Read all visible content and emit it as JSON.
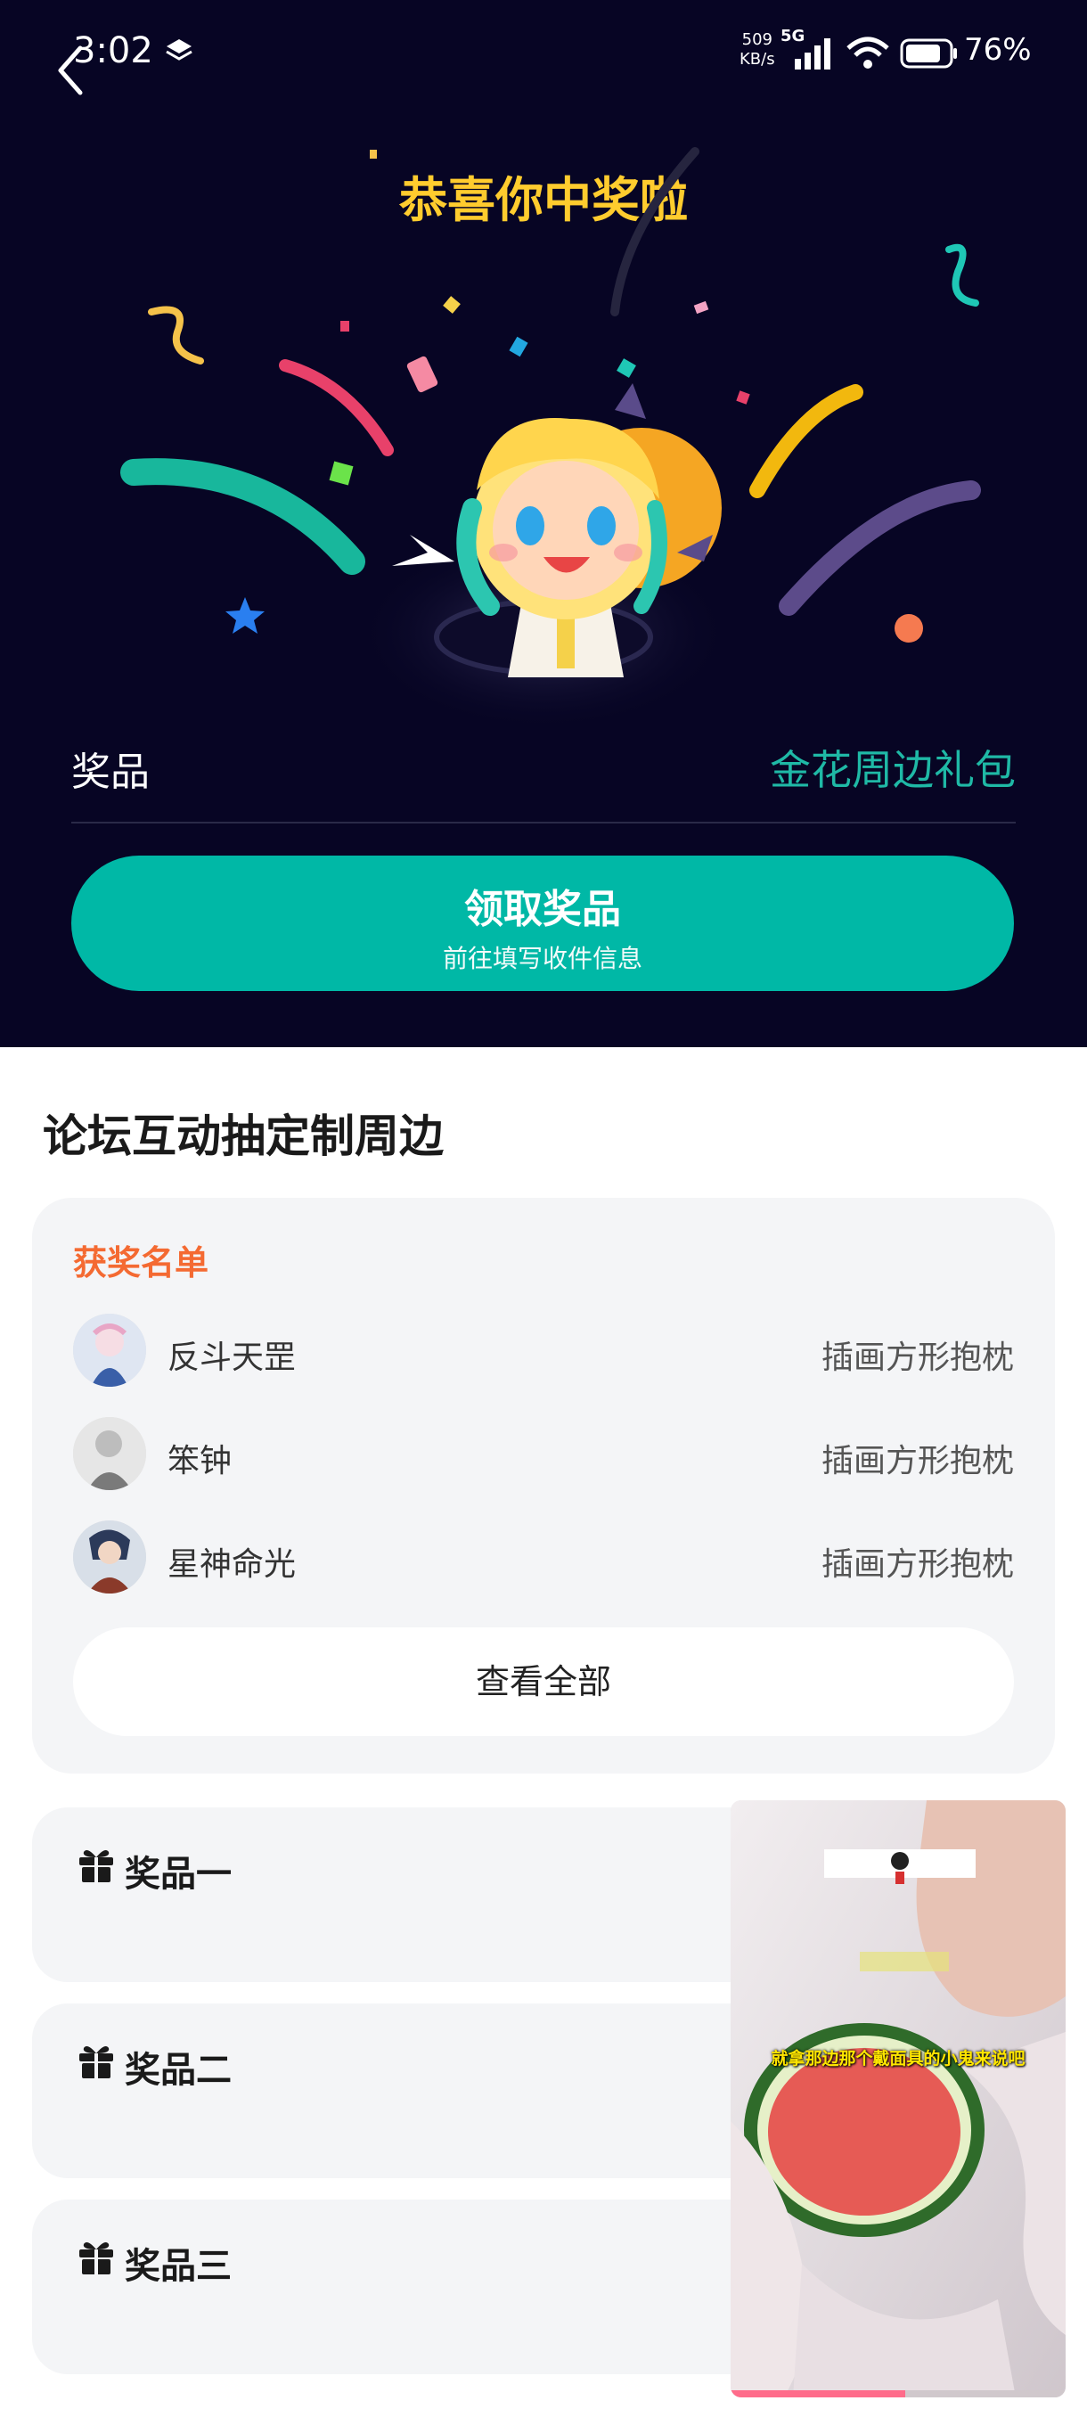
{
  "status_bar": {
    "time": "3:02",
    "net_speed_value": "509",
    "net_speed_unit": "KB/s",
    "network_type": "5G",
    "battery": "76%"
  },
  "hero": {
    "title": "恭喜你中奖啦",
    "prize_label": "奖品",
    "prize_value": "金花周边礼包",
    "claim_button_title": "领取奖品",
    "claim_button_subtitle": "前往填写收件信息"
  },
  "section": {
    "title": "论坛互动抽定制周边"
  },
  "winners": {
    "heading": "获奖名单",
    "list": [
      {
        "name": "反斗天罡",
        "prize": "插画方形抱枕"
      },
      {
        "name": "笨钟",
        "prize": "插画方形抱枕"
      },
      {
        "name": "星神命光",
        "prize": "插画方形抱枕"
      }
    ],
    "view_all_label": "查看全部"
  },
  "prize_cards": [
    {
      "label": "奖品一"
    },
    {
      "label": "奖品二"
    },
    {
      "label": "奖品三"
    }
  ],
  "video": {
    "caption": "就拿那边那个戴面具的小鬼来说吧",
    "progress": 0.52
  },
  "colors": {
    "hero_bg": "#070524",
    "accent_teal": "#00b8a6",
    "title_yellow": "#ffcc2e",
    "winners_orange": "#f46a32"
  }
}
